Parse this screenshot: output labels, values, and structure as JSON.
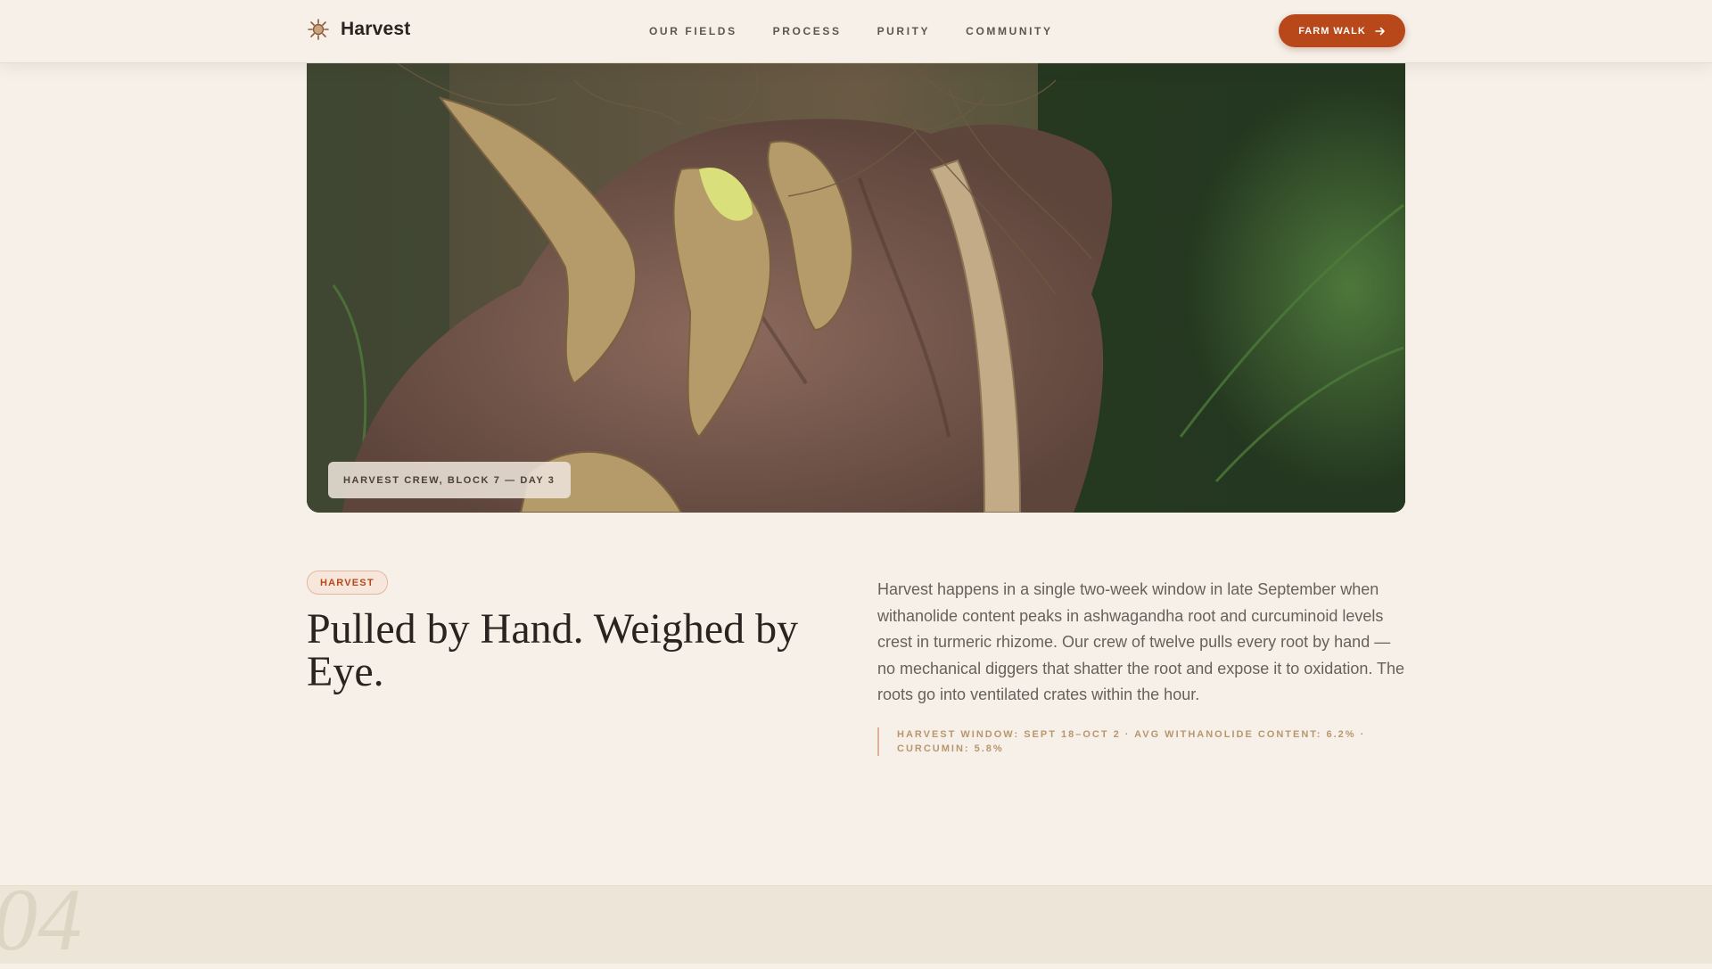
{
  "nav": {
    "brand": "Harvest",
    "brand_icon": "sun-leaf-icon",
    "links": [
      "OUR FIELDS",
      "PROCESS",
      "PURITY",
      "COMMUNITY"
    ],
    "cta_label": "FARM WALK",
    "cta_icon": "arrow-right-icon"
  },
  "hero": {
    "caption": "HARVEST CREW, BLOCK 7 — DAY 3"
  },
  "content": {
    "badge": "HARVEST",
    "headline": "Pulled by Hand. Weighed by Eye.",
    "body": "Harvest happens in a single two-week window in late September when withanolide content peaks in ashwagandha root and curcuminoid levels crest in turmeric rhizome. Our crew of twelve pulls every root by hand — no mechanical diggers that shatter the root and expose it to oxidation. The roots go into ventilated crates within the hour.",
    "stats": "HARVEST WINDOW: SEPT 18–OCT 2 · AVG WITHANOLIDE CONTENT: 6.2% · CURCUMIN: 5.8%"
  },
  "next_section": {
    "number": "04"
  },
  "colors": {
    "accent": "#b8471a",
    "background": "#f6f0e8",
    "stats_text": "#b8976e"
  }
}
